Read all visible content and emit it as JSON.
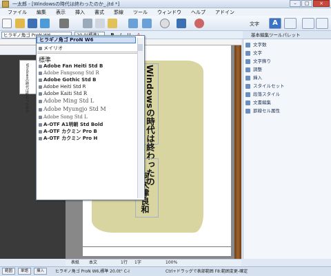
{
  "window": {
    "title": "一太郎 - [Windowsの時代は終わったのか_.jtd *]"
  },
  "menu": [
    "ファイル",
    "編集",
    "表示",
    "挿入",
    "書式",
    "罫線",
    "ツール",
    "ウィンドウ",
    "ヘルプ",
    "アドイン"
  ],
  "toolbar": {
    "font_value": "ヒラギノ角ゴ ProN W6",
    "size_value": "20.0(標準)",
    "mode_label": "文字"
  },
  "font_dropdown": {
    "selected": "ヒラギノ角ゴ ProN W6",
    "recent": [
      "メイリオ"
    ],
    "items": [
      "標準",
      "Adobe Fan Heiti Std B",
      "Adobe Fangsong Std R",
      "Adobe Gothic Std B",
      "Adobe Heiti Std R",
      "Adobe Kaiti Std R",
      "Adobe Ming Std L",
      "Adobe Myungjo Std M",
      "Adobe Song Std L",
      "A-OTF A1明朝 Std Bold",
      "A-OTF カクミン Pro B",
      "A-OTF カクミン Pro H"
    ]
  },
  "thumbnail": {
    "text": "Windowsの時代は終わったのか"
  },
  "document": {
    "title_vertical": "Windowsの時代は終わったのか?",
    "author_vertical": "阿久津良和"
  },
  "right_panel": {
    "header": "基本編集ツールパレット",
    "items": [
      "文字数",
      "文字",
      "文字飾り",
      "調整",
      "挿入",
      "スタイルセット",
      "段落スタイル",
      "文書編集",
      "罫線セル属性"
    ]
  },
  "bottom_bar": {
    "left": "表紙",
    "section": "本文",
    "line": "1行",
    "col": "1字",
    "zoom": "100%"
  },
  "status": {
    "mode_buttons": [
      "範囲",
      "単語",
      "挿入"
    ],
    "font_info": "ヒラギノ角ゴ ProN W6,標準 20.0t° C-I",
    "hint": "Ctrl+ドラッグで表部範囲  F8:範囲変更-確定"
  },
  "colors": {
    "accent": "#3c7fd1",
    "page_bg": "#d8d5a0",
    "strip": "#a0642c"
  }
}
